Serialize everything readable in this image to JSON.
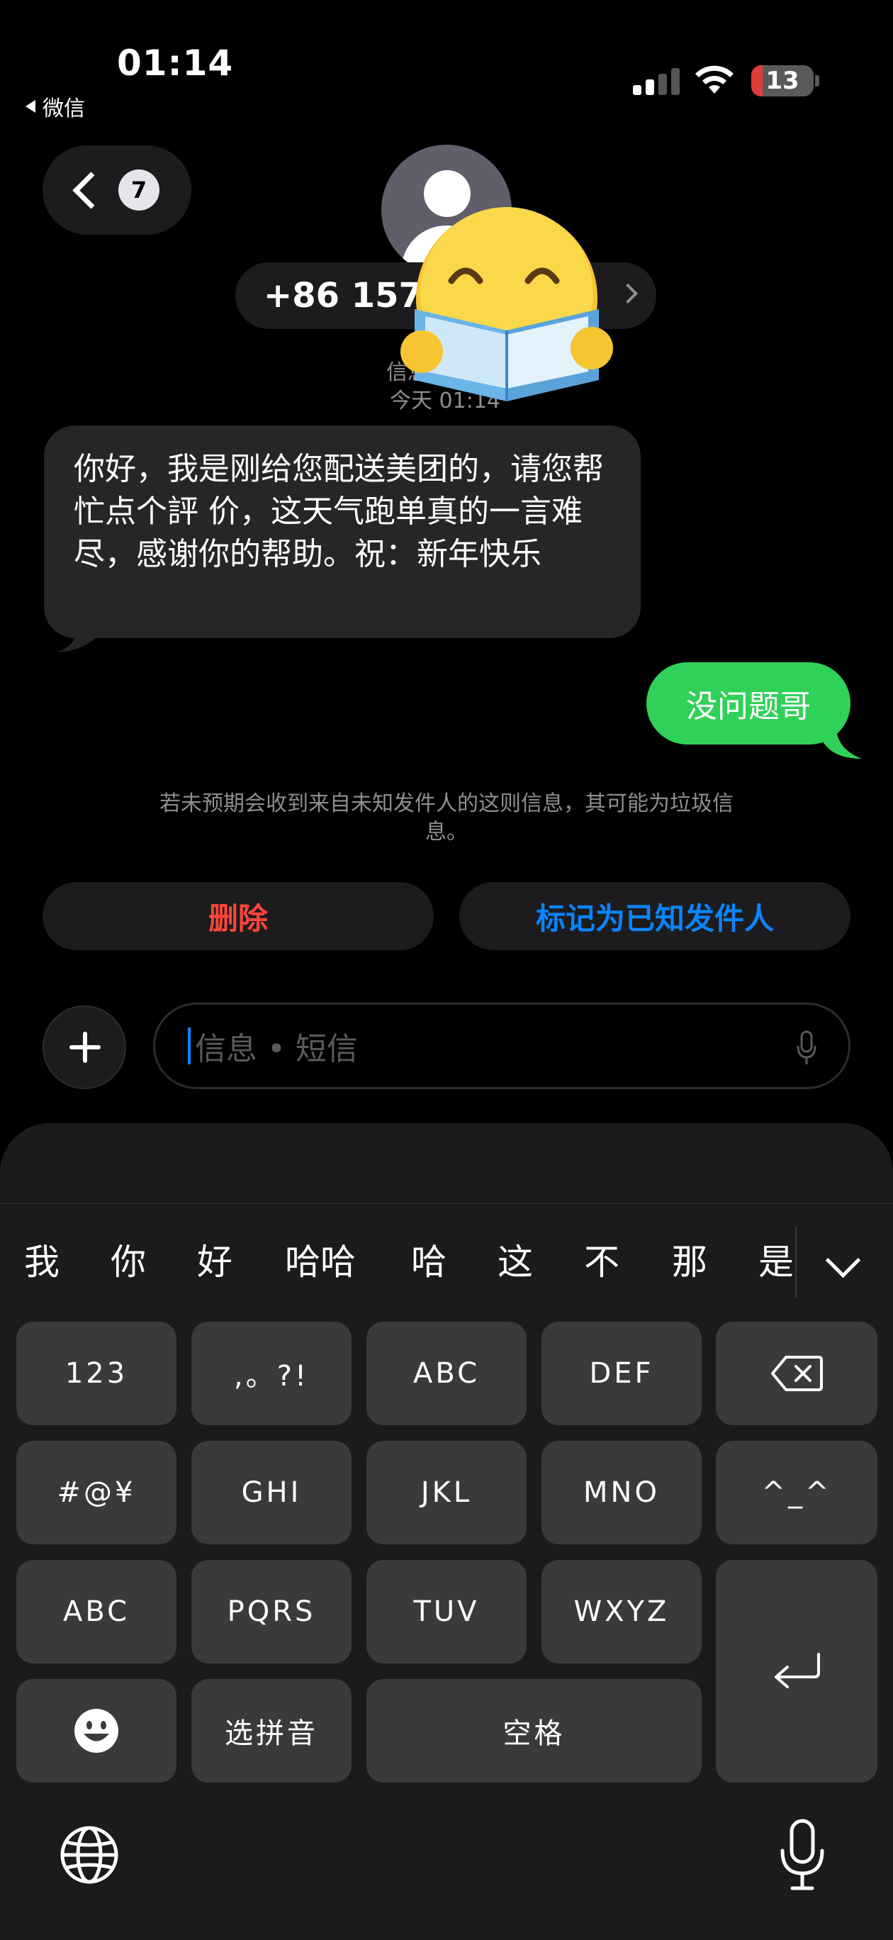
{
  "status_bar": {
    "time": "01:14",
    "back_app": "微信",
    "battery": "13"
  },
  "header": {
    "back_count": "7",
    "contact_number": "+86 157 6",
    "meta_label": "信息",
    "meta_time": "今天 01:14"
  },
  "messages": {
    "incoming": "你好，我是刚给您配送美团的，请您帮忙点个評 价，这天气跑单真的一言难尽，感谢你的帮助。祝：新年快乐",
    "outgoing": "没问题哥"
  },
  "notice": "若未预期会收到来自未知发件人的这则信息，其可能为垃圾信息。",
  "actions": {
    "delete": "删除",
    "mark_known": "标记为已知发件人"
  },
  "composer": {
    "placeholder": "信息 • 短信"
  },
  "keyboard": {
    "candidates": [
      "我",
      "你",
      "好",
      "哈哈",
      "哈",
      "这",
      "不",
      "那",
      "是"
    ],
    "keys": {
      "k123": "123",
      "punct": ",。?!",
      "abc": "ABC",
      "def": "DEF",
      "symbols": "#@¥",
      "ghi": "GHI",
      "jkl": "JKL",
      "mno": "MNO",
      "face": "^_^",
      "abc_switch": "ABC",
      "pqrs": "PQRS",
      "tuv": "TUV",
      "wxyz": "WXYZ",
      "pinyin": "选拼音",
      "space": "空格"
    }
  }
}
